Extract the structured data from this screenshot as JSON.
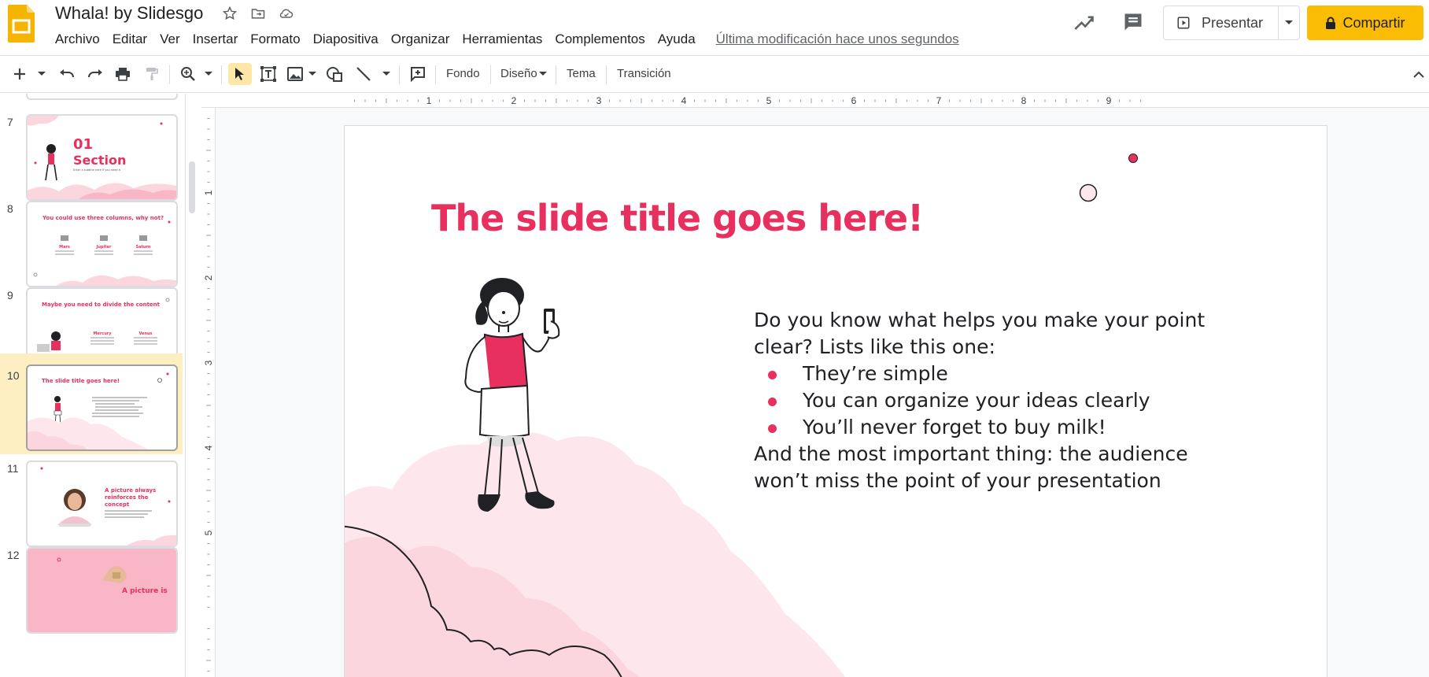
{
  "app": {
    "title": "Whala! by Slidesgo",
    "last_edit": "Última modificación hace unos segundos"
  },
  "menu": [
    "Archivo",
    "Editar",
    "Ver",
    "Insertar",
    "Formato",
    "Diapositiva",
    "Organizar",
    "Herramientas",
    "Complementos",
    "Ayuda"
  ],
  "header_buttons": {
    "present": "Presentar",
    "share": "Compartir"
  },
  "toolbar": {
    "background": "Fondo",
    "layout": "Diseño",
    "theme": "Tema",
    "transition": "Transición"
  },
  "ruler": {
    "h_labels": [
      "1",
      "2",
      "3",
      "4",
      "5",
      "6",
      "7",
      "8",
      "9"
    ],
    "v_labels": [
      "1",
      "2",
      "3",
      "4",
      "5"
    ]
  },
  "filmstrip": {
    "slides": [
      {
        "num": "7",
        "kind": "section",
        "big": "01",
        "title": "Section",
        "sub": "Enter a subtitle here if you need it"
      },
      {
        "num": "8",
        "kind": "three-columns",
        "title": "You could use three columns, why not?",
        "cols": [
          "Mars",
          "Jupiter",
          "Saturn"
        ]
      },
      {
        "num": "9",
        "kind": "divide",
        "title": "Maybe you need to divide the content",
        "cols": [
          "Mercury",
          "Venus"
        ]
      },
      {
        "num": "10",
        "kind": "current",
        "title": "The slide title goes here!",
        "selected": true
      },
      {
        "num": "11",
        "kind": "picture",
        "title_lines": [
          "A picture always",
          "reinforces the",
          "concept"
        ]
      },
      {
        "num": "12",
        "kind": "picture2",
        "title": "A picture is"
      }
    ]
  },
  "slide": {
    "title": "The slide title goes here!",
    "intro": "Do you know what helps you make your point clear? Lists like this one:",
    "bullets": [
      "They’re simple",
      "You can organize your ideas clearly",
      "You’ll never forget to buy milk!"
    ],
    "outro": "And the most important thing: the audience won’t miss the point of your presentation"
  },
  "colors": {
    "accent": "#e8305e",
    "share": "#fbbc04",
    "cloud": "#fcd6df",
    "cloud_light": "#fde7ec",
    "selected_thumb_bg": "#feefc3",
    "active_tool_bg": "#fde8a8"
  },
  "icons": [
    "slides-logo-icon",
    "star-icon",
    "move-to-folder-icon",
    "cloud-status-icon",
    "activity-icon",
    "comment-icon",
    "present-icon",
    "lock-icon",
    "new-slide-icon",
    "undo-icon",
    "redo-icon",
    "print-icon",
    "paint-format-icon",
    "zoom-icon",
    "select-icon",
    "text-box-icon",
    "image-icon",
    "shape-icon",
    "line-icon",
    "comment-add-icon",
    "collapse-icon"
  ]
}
